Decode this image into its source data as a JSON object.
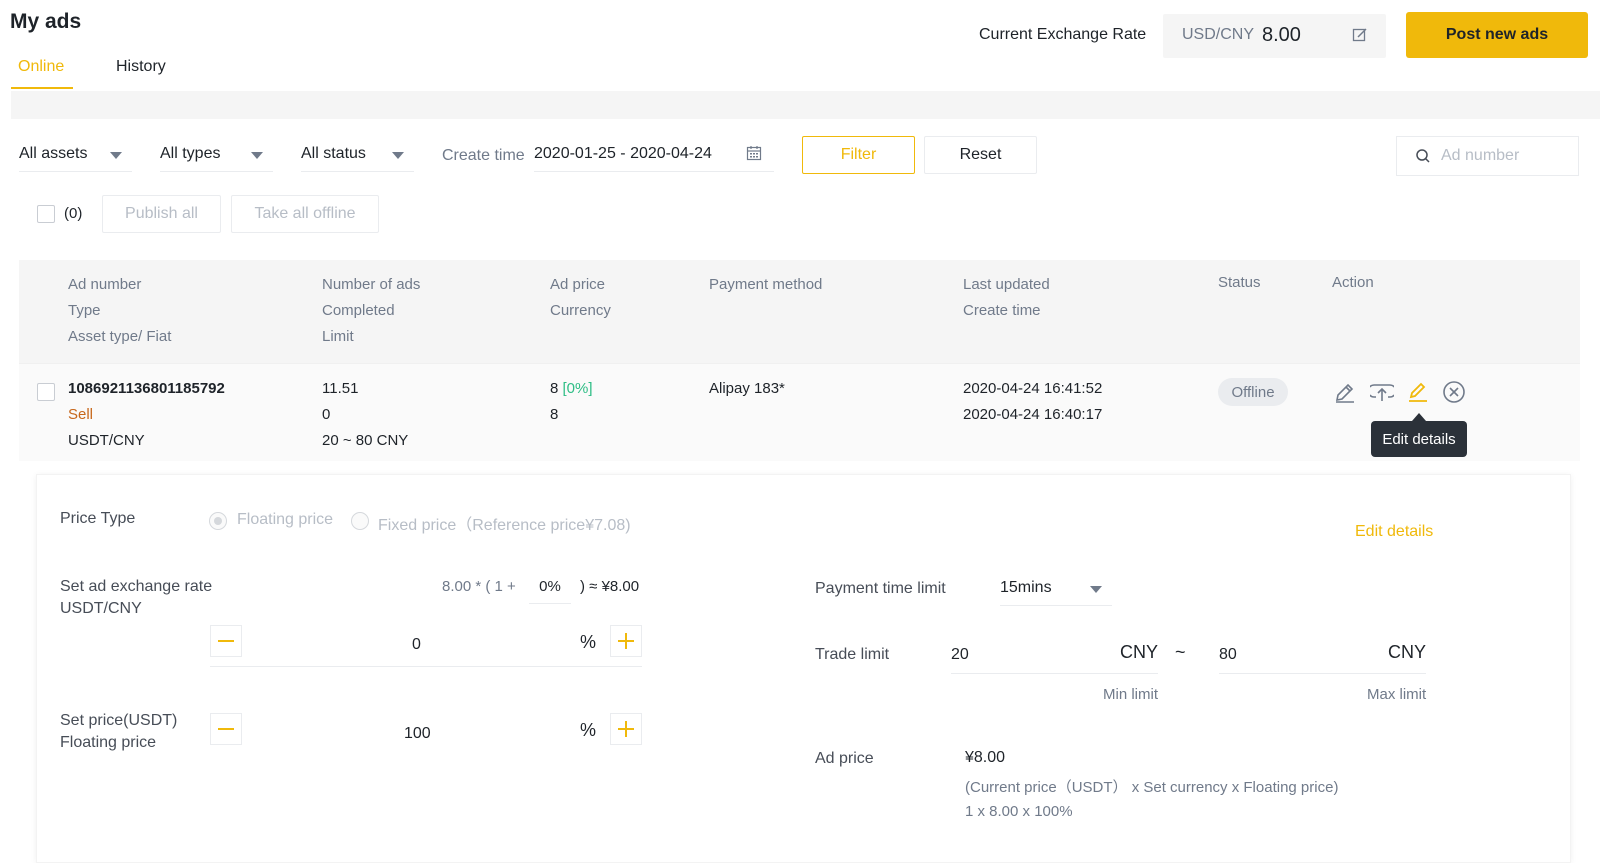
{
  "header": {
    "title": "My ads",
    "tabs": [
      {
        "label": "Online",
        "active": true
      },
      {
        "label": "History",
        "active": false
      }
    ],
    "rate_label": "Current Exchange Rate",
    "rate_currency": "USD/CNY",
    "rate_value": "8.00",
    "post_button": "Post new ads"
  },
  "filters": {
    "assets": "All assets",
    "types": "All types",
    "status": "All status",
    "create_time_label": "Create time",
    "create_time_value": "2020-01-25 - 2020-04-24",
    "filter_button": "Filter",
    "reset_button": "Reset",
    "search_placeholder": "Ad number"
  },
  "bulk": {
    "count": "(0)",
    "publish_all": "Publish all",
    "take_all_offline": "Take all offline"
  },
  "table": {
    "headers": {
      "col1": [
        "Ad number",
        "Type",
        "Asset type/ Fiat"
      ],
      "col2": [
        "Number of ads",
        "Completed",
        "Limit"
      ],
      "col3": [
        "Ad price",
        "Currency"
      ],
      "col4": [
        "Payment method"
      ],
      "col5": [
        "Last updated",
        "Create time"
      ],
      "status": "Status",
      "action": "Action"
    },
    "row": {
      "ad_number": "1086921136801185792",
      "type": "Sell",
      "asset_fiat": "USDT/CNY",
      "number_of_ads": "11.51",
      "completed": "0",
      "limit": "20 ~ 80 CNY",
      "ad_price": "8",
      "ad_price_pct": "[0%]",
      "currency": "8",
      "payment_method": "Alipay 183*",
      "last_updated": "2020-04-24 16:41:52",
      "create_time": "2020-04-24 16:40:17",
      "status": "Offline"
    },
    "tooltip": "Edit details"
  },
  "detail": {
    "price_type_label": "Price Type",
    "floating_price": "Floating price",
    "fixed_price": "Fixed price（Reference price¥7.08)",
    "edit_details": "Edit details",
    "set_rate_label": "Set ad exchange rate",
    "set_rate_pair": "USDT/CNY",
    "formula_prefix": "8.00 * ( 1 +",
    "formula_pct": "0%",
    "formula_suffix": ") ≈ ¥8.00",
    "rate_stepper_value": "0",
    "pct_symbol": "%",
    "set_price_label": "Set price(USDT)",
    "floating_price_label": "Floating price",
    "price_stepper_value": "100",
    "payment_time_label": "Payment time limit",
    "payment_time_value": "15mins",
    "trade_limit_label": "Trade limit",
    "min_value": "20",
    "max_value": "80",
    "cny": "CNY",
    "tilde": "~",
    "min_limit": "Min limit",
    "max_limit": "Max limit",
    "ad_price_label": "Ad price",
    "ad_price_value": "¥8.00",
    "ad_price_formula": "(Current price（USDT） x Set currency x Floating price)",
    "ad_price_calc": "1 x 8.00 x 100%"
  },
  "colors": {
    "accent": "#f0b90b",
    "sell": "#c7671b",
    "green": "#2ebd85"
  }
}
